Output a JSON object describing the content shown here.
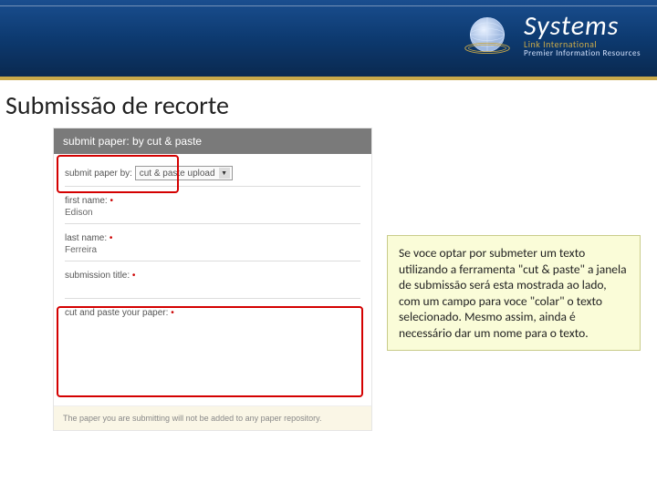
{
  "logo": {
    "title": "Systems",
    "sub1": "Link International",
    "sub2": "Premier Information Resources"
  },
  "slide_title": "Submissão de recorte",
  "form": {
    "header": "submit paper: by cut & paste",
    "submit_by_label": "submit paper by:",
    "submit_by_value": "cut & paste upload",
    "first_name_label": "first name:",
    "first_name_value": "Edison",
    "last_name_label": "last name:",
    "last_name_value": "Ferreira",
    "title_label": "submission title:",
    "paste_label": "cut and paste your paper:",
    "footer": "The paper you are submitting will not be added to any paper repository."
  },
  "info_text": "Se voce optar por submeter um texto utilizando a ferramenta \"cut & paste\" a janela de submissão será esta mostrada ao lado, com um campo para voce \"colar\" o texto selecionado. Mesmo assim, ainda é necessário dar um nome para o texto."
}
